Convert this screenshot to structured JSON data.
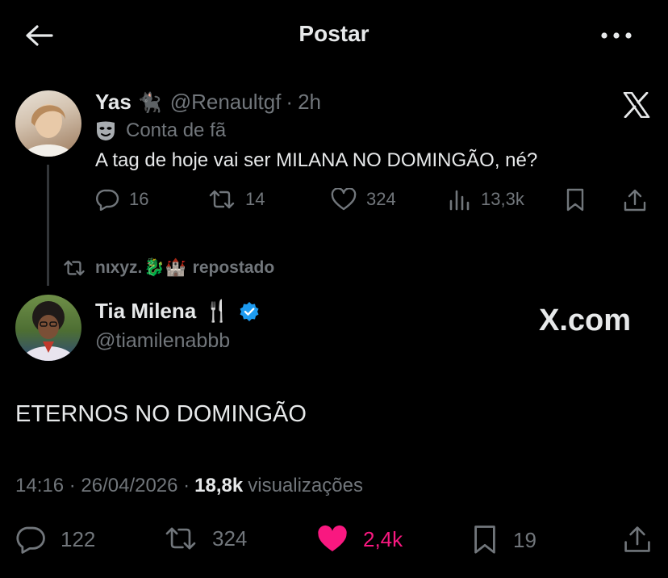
{
  "header": {
    "title": "Postar"
  },
  "quoted_tweet": {
    "name": "Yas",
    "name_emoji": "🐈‍⬛",
    "handle": "@Renaultgf",
    "separator": "·",
    "time_ago": "2h",
    "label": "Conta de fã",
    "text": "A tag de hoje vai ser MILANA NO DOMINGÃO, né?",
    "replies": "16",
    "retweets": "14",
    "likes": "324",
    "views": "13,3k"
  },
  "repost": {
    "user": "nιxyz.",
    "emojis": "🐉🏰",
    "label": "repostado"
  },
  "main_tweet": {
    "name": "Tia Milena",
    "name_emoji": "🍴",
    "handle": "@tiamilenabbb",
    "watermark": "X.com",
    "text": "ETERNOS NO DOMINGÃO",
    "timestamp": "14:16 · 26/04/2026 ·",
    "views_count": "18,8k",
    "views_label": "visualizações",
    "replies": "122",
    "retweets": "324",
    "likes": "2,4k",
    "bookmarks": "19"
  },
  "colors": {
    "background": "#000000",
    "text_primary": "#e7e9ea",
    "text_secondary": "#71767b",
    "like_active": "#f91880",
    "verified_badge": "#1d9bf0"
  },
  "icons": [
    "back-arrow-icon",
    "more-icon",
    "x-logo-icon",
    "theater-mask-icon",
    "reply-icon",
    "retweet-icon",
    "heart-icon",
    "views-icon",
    "bookmark-icon",
    "share-icon",
    "verified-badge-icon"
  ]
}
